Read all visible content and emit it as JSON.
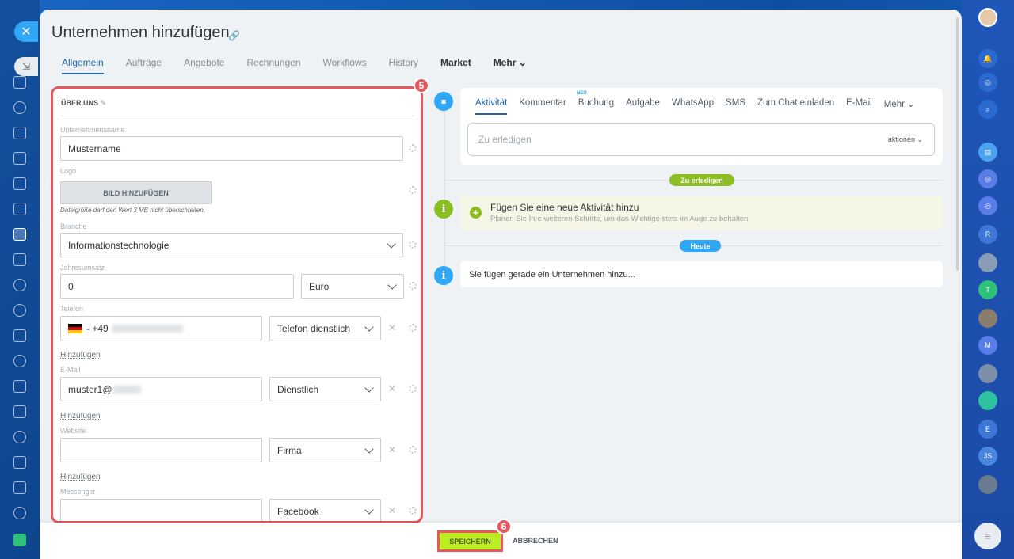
{
  "page": {
    "title": "Unternehmen hinzufügen",
    "tabs": [
      {
        "label": "Allgemein"
      },
      {
        "label": "Aufträge"
      },
      {
        "label": "Angebote"
      },
      {
        "label": "Rechnungen"
      },
      {
        "label": "Workflows"
      },
      {
        "label": "History"
      },
      {
        "label": "Market"
      },
      {
        "label": "Mehr ⌄"
      }
    ]
  },
  "form": {
    "section_title": "ÜBER UNS",
    "badge": "5",
    "company_name_label": "Unternehmensname",
    "company_name_value": "Mustername",
    "logo_label": "Logo",
    "logo_button": "BILD HINZUFÜGEN",
    "logo_hint": "Dateigröße darf den Wert 3 MB nicht überschreiten.",
    "industry_label": "Branche",
    "industry_value": "Informationstechnologie",
    "revenue_label": "Jahresumsatz",
    "revenue_value": "0",
    "currency_value": "Euro",
    "phone_label": "Telefon",
    "phone_prefix": "- +49",
    "phone_type": "Telefon dienstlich",
    "add_1": "Hinzufügen",
    "email_label": "E-Mail",
    "email_value": "muster1@",
    "email_type": "Dienstlich",
    "add_2": "Hinzufügen",
    "website_label": "Website",
    "website_value": "",
    "website_type": "Firma",
    "add_3": "Hinzufügen",
    "messenger_label": "Messenger",
    "messenger_value": "",
    "messenger_type": "Facebook"
  },
  "activity": {
    "tabs": [
      {
        "label": "Aktivität"
      },
      {
        "label": "Kommentar"
      },
      {
        "label": "Buchung"
      },
      {
        "label": "Aufgabe"
      },
      {
        "label": "WhatsApp"
      },
      {
        "label": "SMS"
      },
      {
        "label": "Zum Chat einladen"
      },
      {
        "label": "E-Mail"
      },
      {
        "label": "Mehr ⌄"
      }
    ],
    "new_badge": "NEU",
    "input_placeholder": "Zu erledigen",
    "actions_label": "aktionen ⌄",
    "pill_todo": "Zu erledigen",
    "todo_title": "Fügen Sie eine neue Aktivität hinzu",
    "todo_subtitle": "Planen Sie Ihre weiteren Schritte, um das Wichtige stets im Auge zu behalten",
    "pill_today": "Heute",
    "info_text": "Sie fügen gerade ein Unternehmen hinzu..."
  },
  "footer": {
    "save_label": "SPEICHERN",
    "cancel_label": "ABBRECHEN",
    "badge": "6"
  },
  "right_bar": {
    "initials": [
      "R",
      "T",
      "M",
      "E",
      "JS"
    ]
  },
  "colors": {
    "accent": "#2067b0",
    "save": "#bbed21",
    "highlight": "#e4585e",
    "green": "#8cbd23",
    "blue_pill": "#2fa7f5"
  }
}
